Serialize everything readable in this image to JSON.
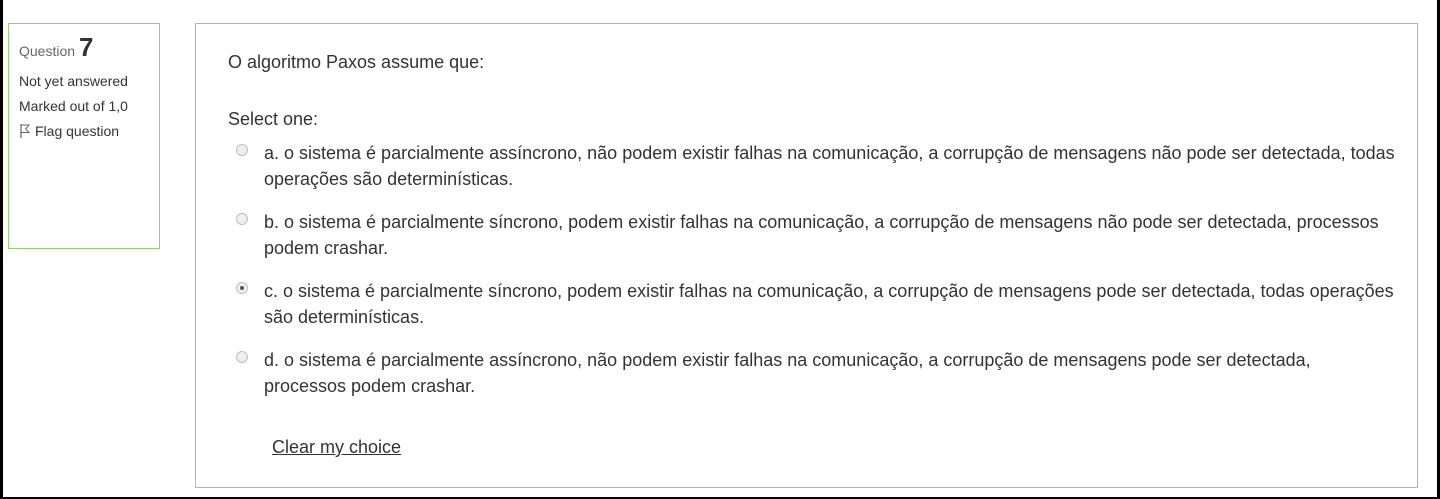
{
  "info": {
    "question_label": "Question",
    "question_number": "7",
    "state": "Not yet answered",
    "grade": "Marked out of 1,0",
    "flag_label": "Flag question"
  },
  "question": {
    "text": "O algoritmo Paxos assume que:",
    "prompt": "Select one:",
    "options": [
      {
        "label": "a. o sistema é parcialmente assíncrono, não podem existir falhas na comunicação, a corrupção de mensagens não pode ser detectada, todas operações são determinísticas.",
        "selected": false
      },
      {
        "label": "b. o sistema é parcialmente síncrono, podem existir falhas na comunicação, a corrupção de mensagens não pode ser detectada, processos podem crashar.",
        "selected": false
      },
      {
        "label": "c. o sistema é parcialmente síncrono, podem existir falhas na comunicação, a corrupção de mensagens pode ser detectada, todas operações são determinísticas.",
        "selected": true
      },
      {
        "label": "d. o sistema é parcialmente assíncrono, não podem existir falhas na comunicação, a corrupção de mensagens pode ser detectada, processos podem crashar.",
        "selected": false
      }
    ],
    "clear_label": "Clear my choice"
  },
  "colors": {
    "border": "#8fd173",
    "text": "#333333"
  }
}
